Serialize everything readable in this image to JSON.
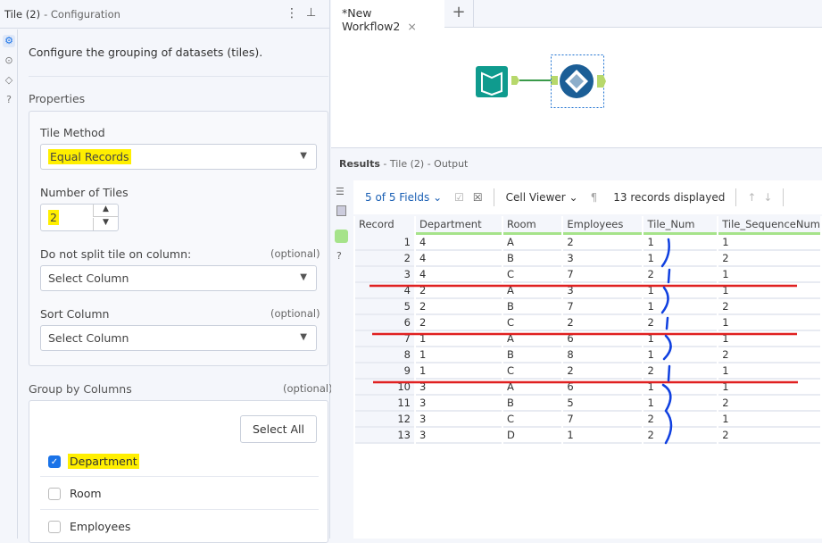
{
  "config": {
    "title": "Tile (2)",
    "subtitle": "- Configuration",
    "description": "Configure the grouping of datasets (tiles).",
    "properties_heading": "Properties",
    "tile_method_label": "Tile Method",
    "tile_method_value": "Equal Records",
    "num_tiles_label": "Number of Tiles",
    "num_tiles_value": "2",
    "no_split_label": "Do not split tile on column:",
    "optional": "(optional)",
    "no_split_value": "Select Column",
    "sort_label": "Sort Column",
    "sort_value": "Select Column",
    "group_label": "Group by Columns",
    "select_all": "Select All",
    "group_columns": [
      {
        "name": "Department",
        "checked": true
      },
      {
        "name": "Room",
        "checked": false
      },
      {
        "name": "Employees",
        "checked": false
      }
    ]
  },
  "workflow": {
    "tab": "*New Workflow2",
    "add_tab": "+"
  },
  "results": {
    "title": "Results",
    "subtitle": "- Tile (2) - Output",
    "fields": "5 of 5 Fields",
    "viewer": "Cell Viewer",
    "records_displayed": "13 records displayed",
    "columns": [
      "Record",
      "Department",
      "Room",
      "Employees",
      "Tile_Num",
      "Tile_SequenceNum"
    ],
    "rows": [
      [
        "1",
        "4",
        "A",
        "2",
        "1",
        "1"
      ],
      [
        "2",
        "4",
        "B",
        "3",
        "1",
        "2"
      ],
      [
        "3",
        "4",
        "C",
        "7",
        "2",
        "1"
      ],
      [
        "4",
        "2",
        "A",
        "3",
        "1",
        "1"
      ],
      [
        "5",
        "2",
        "B",
        "7",
        "1",
        "2"
      ],
      [
        "6",
        "2",
        "C",
        "2",
        "2",
        "1"
      ],
      [
        "7",
        "1",
        "A",
        "6",
        "1",
        "1"
      ],
      [
        "8",
        "1",
        "B",
        "8",
        "1",
        "2"
      ],
      [
        "9",
        "1",
        "C",
        "2",
        "2",
        "1"
      ],
      [
        "10",
        "3",
        "A",
        "6",
        "1",
        "1"
      ],
      [
        "11",
        "3",
        "B",
        "5",
        "1",
        "2"
      ],
      [
        "12",
        "3",
        "C",
        "7",
        "2",
        "1"
      ],
      [
        "13",
        "3",
        "D",
        "1",
        "2",
        "2"
      ]
    ]
  },
  "colors": {
    "accent": "#1a73e8",
    "highlight": "#ffef00",
    "annotation_red": "#e02020",
    "annotation_blue": "#1040e0"
  }
}
